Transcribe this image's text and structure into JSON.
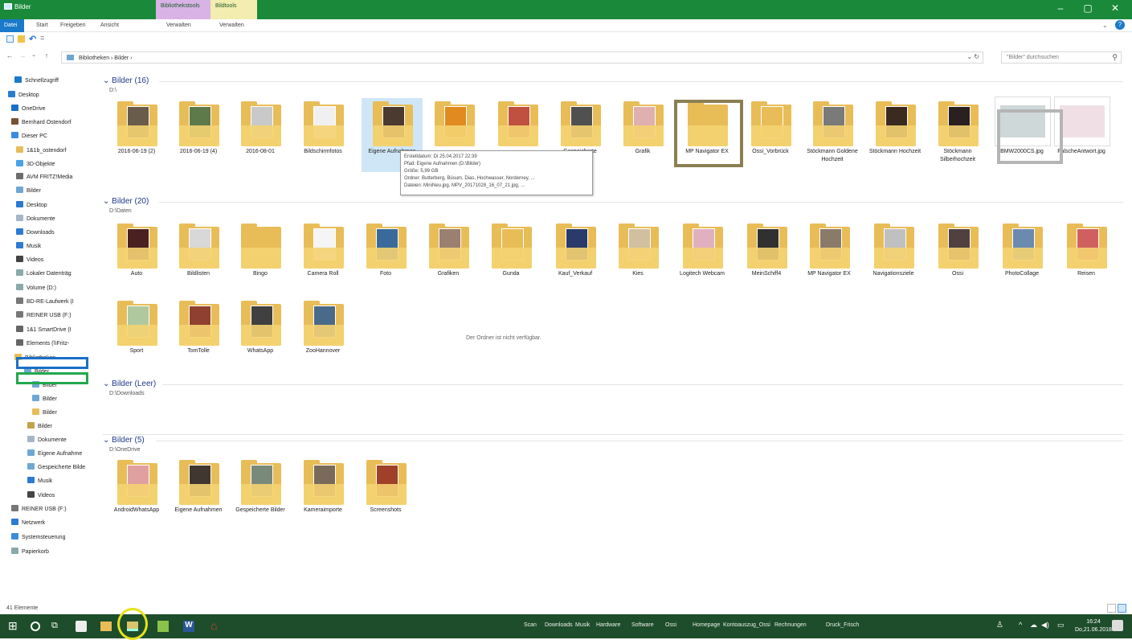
{
  "window": {
    "title": "Bilder",
    "ctx_tab_1": "Bibliothekstools",
    "ctx_tab_2": "Bildtools",
    "min": "–",
    "max": "▢",
    "close": "✕"
  },
  "ribbon": {
    "tabs": [
      "Datei",
      "Start",
      "Freigeben",
      "Ansicht",
      "Verwalten",
      "Verwalten"
    ],
    "help": "?"
  },
  "address": {
    "path": "Bibliotheken › Bilder ›",
    "search_placeholder": "\"Bilder\" durchsuchen"
  },
  "sidebar": {
    "items": [
      {
        "label": "Schnellzugriff",
        "icon": "star-icon",
        "color": "#1979ca"
      },
      {
        "label": "Desktop",
        "icon": "desktop-icon",
        "color": "#2b7bd3"
      },
      {
        "label": "OneDrive",
        "icon": "cloud-icon",
        "color": "#1a6fc7"
      },
      {
        "label": "Bernhard Ostendorf",
        "icon": "user-icon",
        "color": "#7a5230"
      },
      {
        "label": "Dieser PC",
        "icon": "pc-icon",
        "color": "#3a8ddc"
      },
      {
        "label": "1&1b_ostendorf",
        "icon": "folder-icon",
        "color": "#e8bd58"
      },
      {
        "label": "3D-Objekte",
        "icon": "cube-icon",
        "color": "#48a3e8"
      },
      {
        "label": "AVM FRITZ!Media",
        "icon": "media-icon",
        "color": "#6d6d6d"
      },
      {
        "label": "Bilder",
        "icon": "pictures-icon",
        "color": "#6fa7d3"
      },
      {
        "label": "Desktop",
        "icon": "desktop-icon",
        "color": "#2b7bd3"
      },
      {
        "label": "Dokumente",
        "icon": "documents-icon",
        "color": "#a7b6c6"
      },
      {
        "label": "Downloads",
        "icon": "download-icon",
        "color": "#2b7bd3"
      },
      {
        "label": "Musik",
        "icon": "music-icon",
        "color": "#2b7bd3"
      },
      {
        "label": "Videos",
        "icon": "video-icon",
        "color": "#444"
      },
      {
        "label": "Lokaler Datenträg",
        "icon": "drive-icon",
        "color": "#8aa"
      },
      {
        "label": "Volume (D:)",
        "icon": "drive-icon",
        "color": "#8aa"
      },
      {
        "label": "BD-RE-Laufwerk (I",
        "icon": "disc-icon",
        "color": "#777"
      },
      {
        "label": "REINER USB (F:)",
        "icon": "usb-icon",
        "color": "#777"
      },
      {
        "label": "1&1 SmartDrive (I",
        "icon": "network-drive-icon",
        "color": "#666"
      },
      {
        "label": "Elements (\\\\Fritz-",
        "icon": "network-drive-icon",
        "color": "#666"
      },
      {
        "label": "Bibliotheken",
        "icon": "library-icon",
        "color": "#e8bd58"
      },
      {
        "label": "Bilder",
        "icon": "pictures-icon",
        "color": "#6fa7d3"
      },
      {
        "label": "Bilder",
        "icon": "pictures-icon",
        "color": "#6fa7d3"
      },
      {
        "label": "Bilder",
        "icon": "pictures-icon",
        "color": "#6fa7d3"
      },
      {
        "label": "Bilder",
        "icon": "folder-icon",
        "color": "#e8bd58"
      },
      {
        "label": "Bilder",
        "icon": "pictures-icon",
        "color": "#c4a24a"
      },
      {
        "label": "Dokumente",
        "icon": "documents-icon",
        "color": "#a7b6c6"
      },
      {
        "label": "Eigene Aufnahme",
        "icon": "pictures-icon",
        "color": "#6fa7d3"
      },
      {
        "label": "Gespeicherte Bilde",
        "icon": "pictures-icon",
        "color": "#6fa7d3"
      },
      {
        "label": "Musik",
        "icon": "music-icon",
        "color": "#2b7bd3"
      },
      {
        "label": "Videos",
        "icon": "video-icon",
        "color": "#444"
      },
      {
        "label": "REINER USB (F:)",
        "icon": "usb-icon",
        "color": "#777"
      },
      {
        "label": "Netzwerk",
        "icon": "network-icon",
        "color": "#2b7bd3"
      },
      {
        "label": "Systemsteuerung",
        "icon": "control-panel-icon",
        "color": "#3a8ddc"
      },
      {
        "label": "Papierkorb",
        "icon": "recycle-bin-icon",
        "color": "#8aa"
      }
    ]
  },
  "groups": [
    {
      "title": "Bilder (16)",
      "path": "D:\\"
    },
    {
      "title": "Bilder (20)",
      "path": "D:\\Daten"
    },
    {
      "title": "Bilder (Leer)",
      "path": "D:\\Downloads"
    },
    {
      "title": "Bilder (5)",
      "path": "D:\\OneDrive"
    }
  ],
  "group1_items": [
    "2016-06-19 (2)",
    "2016-06-19 (4)",
    "2016-08-01",
    "Bildschirmfotos",
    "Eigene Aufnahmen",
    "",
    "",
    "Gespeicherte",
    "Grafik",
    "MP Navigator EX",
    "Ossi_Vorbrück",
    "Stöckmann Goldene Hochzeit",
    "Stöckmann Hochzeit",
    "Stöckmann Silberhochzeit",
    "BMW2000CS.jpg",
    "FalscheAntwort.jpg"
  ],
  "group2_items": [
    "Auto",
    "Bildlisten",
    "Bingo",
    "Camera Roll",
    "Foto",
    "Grafiken",
    "Gunda",
    "Kauf_Verkauf",
    "Kies",
    "Logitech Webcam",
    "MeinSchiff4",
    "MP Navigator EX",
    "Navigationsziele",
    "Ossi",
    "PhotoCollage",
    "Reisen",
    "Sport",
    "TomTolle",
    "WhatsApp",
    "ZooHannover"
  ],
  "group3_empty": "Der Ordner ist nicht verfügbar.",
  "group4_items": [
    "AndroidWhatsApp",
    "Eigene Aufnahmen",
    "Gespeicherte Bilder",
    "Kameraimporte",
    "Screenshots"
  ],
  "tooltip": {
    "line1": "Erstelldatum: Di 25.04.2017 22:39",
    "line2": "Pfad: Eigene Aufnahmen (D:\\Bilder)",
    "line3": "Größe: 5,99 GB",
    "line4": "Ordner: Butterberg, Büsum, Dias, Hochwasser, Norderney, ...",
    "line5": "Dateien: MiniNeu.jpg, MPV_20171028_16_07_21.jpg, ..."
  },
  "status": {
    "count": "41 Elemente"
  },
  "taskbar": {
    "links": [
      "Scan",
      "Downloads",
      "Musik",
      "Hardware",
      "Software",
      "Ossi",
      "Homepage",
      "Kontoauszug_Ossi",
      "Rechnungen",
      "Druck_Frisch"
    ],
    "time": "16:24",
    "date": "Do,21.06.2018"
  }
}
